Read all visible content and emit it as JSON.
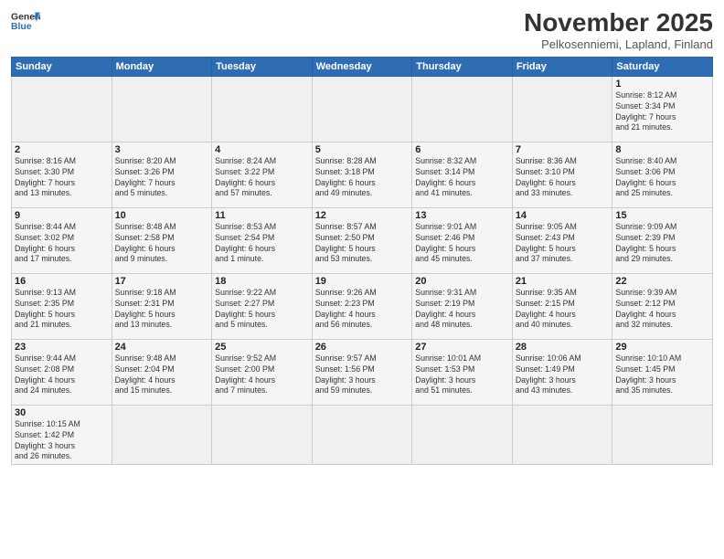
{
  "logo": {
    "line1": "General",
    "line2": "Blue"
  },
  "title": "November 2025",
  "subtitle": "Pelkosenniemi, Lapland, Finland",
  "days_of_week": [
    "Sunday",
    "Monday",
    "Tuesday",
    "Wednesday",
    "Thursday",
    "Friday",
    "Saturday"
  ],
  "weeks": [
    [
      {
        "day": "",
        "info": ""
      },
      {
        "day": "",
        "info": ""
      },
      {
        "day": "",
        "info": ""
      },
      {
        "day": "",
        "info": ""
      },
      {
        "day": "",
        "info": ""
      },
      {
        "day": "",
        "info": ""
      },
      {
        "day": "1",
        "info": "Sunrise: 8:12 AM\nSunset: 3:34 PM\nDaylight: 7 hours\nand 21 minutes."
      }
    ],
    [
      {
        "day": "2",
        "info": "Sunrise: 8:16 AM\nSunset: 3:30 PM\nDaylight: 7 hours\nand 13 minutes."
      },
      {
        "day": "3",
        "info": "Sunrise: 8:20 AM\nSunset: 3:26 PM\nDaylight: 7 hours\nand 5 minutes."
      },
      {
        "day": "4",
        "info": "Sunrise: 8:24 AM\nSunset: 3:22 PM\nDaylight: 6 hours\nand 57 minutes."
      },
      {
        "day": "5",
        "info": "Sunrise: 8:28 AM\nSunset: 3:18 PM\nDaylight: 6 hours\nand 49 minutes."
      },
      {
        "day": "6",
        "info": "Sunrise: 8:32 AM\nSunset: 3:14 PM\nDaylight: 6 hours\nand 41 minutes."
      },
      {
        "day": "7",
        "info": "Sunrise: 8:36 AM\nSunset: 3:10 PM\nDaylight: 6 hours\nand 33 minutes."
      },
      {
        "day": "8",
        "info": "Sunrise: 8:40 AM\nSunset: 3:06 PM\nDaylight: 6 hours\nand 25 minutes."
      }
    ],
    [
      {
        "day": "9",
        "info": "Sunrise: 8:44 AM\nSunset: 3:02 PM\nDaylight: 6 hours\nand 17 minutes."
      },
      {
        "day": "10",
        "info": "Sunrise: 8:48 AM\nSunset: 2:58 PM\nDaylight: 6 hours\nand 9 minutes."
      },
      {
        "day": "11",
        "info": "Sunrise: 8:53 AM\nSunset: 2:54 PM\nDaylight: 6 hours\nand 1 minute."
      },
      {
        "day": "12",
        "info": "Sunrise: 8:57 AM\nSunset: 2:50 PM\nDaylight: 5 hours\nand 53 minutes."
      },
      {
        "day": "13",
        "info": "Sunrise: 9:01 AM\nSunset: 2:46 PM\nDaylight: 5 hours\nand 45 minutes."
      },
      {
        "day": "14",
        "info": "Sunrise: 9:05 AM\nSunset: 2:43 PM\nDaylight: 5 hours\nand 37 minutes."
      },
      {
        "day": "15",
        "info": "Sunrise: 9:09 AM\nSunset: 2:39 PM\nDaylight: 5 hours\nand 29 minutes."
      }
    ],
    [
      {
        "day": "16",
        "info": "Sunrise: 9:13 AM\nSunset: 2:35 PM\nDaylight: 5 hours\nand 21 minutes."
      },
      {
        "day": "17",
        "info": "Sunrise: 9:18 AM\nSunset: 2:31 PM\nDaylight: 5 hours\nand 13 minutes."
      },
      {
        "day": "18",
        "info": "Sunrise: 9:22 AM\nSunset: 2:27 PM\nDaylight: 5 hours\nand 5 minutes."
      },
      {
        "day": "19",
        "info": "Sunrise: 9:26 AM\nSunset: 2:23 PM\nDaylight: 4 hours\nand 56 minutes."
      },
      {
        "day": "20",
        "info": "Sunrise: 9:31 AM\nSunset: 2:19 PM\nDaylight: 4 hours\nand 48 minutes."
      },
      {
        "day": "21",
        "info": "Sunrise: 9:35 AM\nSunset: 2:15 PM\nDaylight: 4 hours\nand 40 minutes."
      },
      {
        "day": "22",
        "info": "Sunrise: 9:39 AM\nSunset: 2:12 PM\nDaylight: 4 hours\nand 32 minutes."
      }
    ],
    [
      {
        "day": "23",
        "info": "Sunrise: 9:44 AM\nSunset: 2:08 PM\nDaylight: 4 hours\nand 24 minutes."
      },
      {
        "day": "24",
        "info": "Sunrise: 9:48 AM\nSunset: 2:04 PM\nDaylight: 4 hours\nand 15 minutes."
      },
      {
        "day": "25",
        "info": "Sunrise: 9:52 AM\nSunset: 2:00 PM\nDaylight: 4 hours\nand 7 minutes."
      },
      {
        "day": "26",
        "info": "Sunrise: 9:57 AM\nSunset: 1:56 PM\nDaylight: 3 hours\nand 59 minutes."
      },
      {
        "day": "27",
        "info": "Sunrise: 10:01 AM\nSunset: 1:53 PM\nDaylight: 3 hours\nand 51 minutes."
      },
      {
        "day": "28",
        "info": "Sunrise: 10:06 AM\nSunset: 1:49 PM\nDaylight: 3 hours\nand 43 minutes."
      },
      {
        "day": "29",
        "info": "Sunrise: 10:10 AM\nSunset: 1:45 PM\nDaylight: 3 hours\nand 35 minutes."
      }
    ],
    [
      {
        "day": "30",
        "info": "Sunrise: 10:15 AM\nSunset: 1:42 PM\nDaylight: 3 hours\nand 26 minutes."
      },
      {
        "day": "",
        "info": ""
      },
      {
        "day": "",
        "info": ""
      },
      {
        "day": "",
        "info": ""
      },
      {
        "day": "",
        "info": ""
      },
      {
        "day": "",
        "info": ""
      },
      {
        "day": "",
        "info": ""
      }
    ]
  ]
}
